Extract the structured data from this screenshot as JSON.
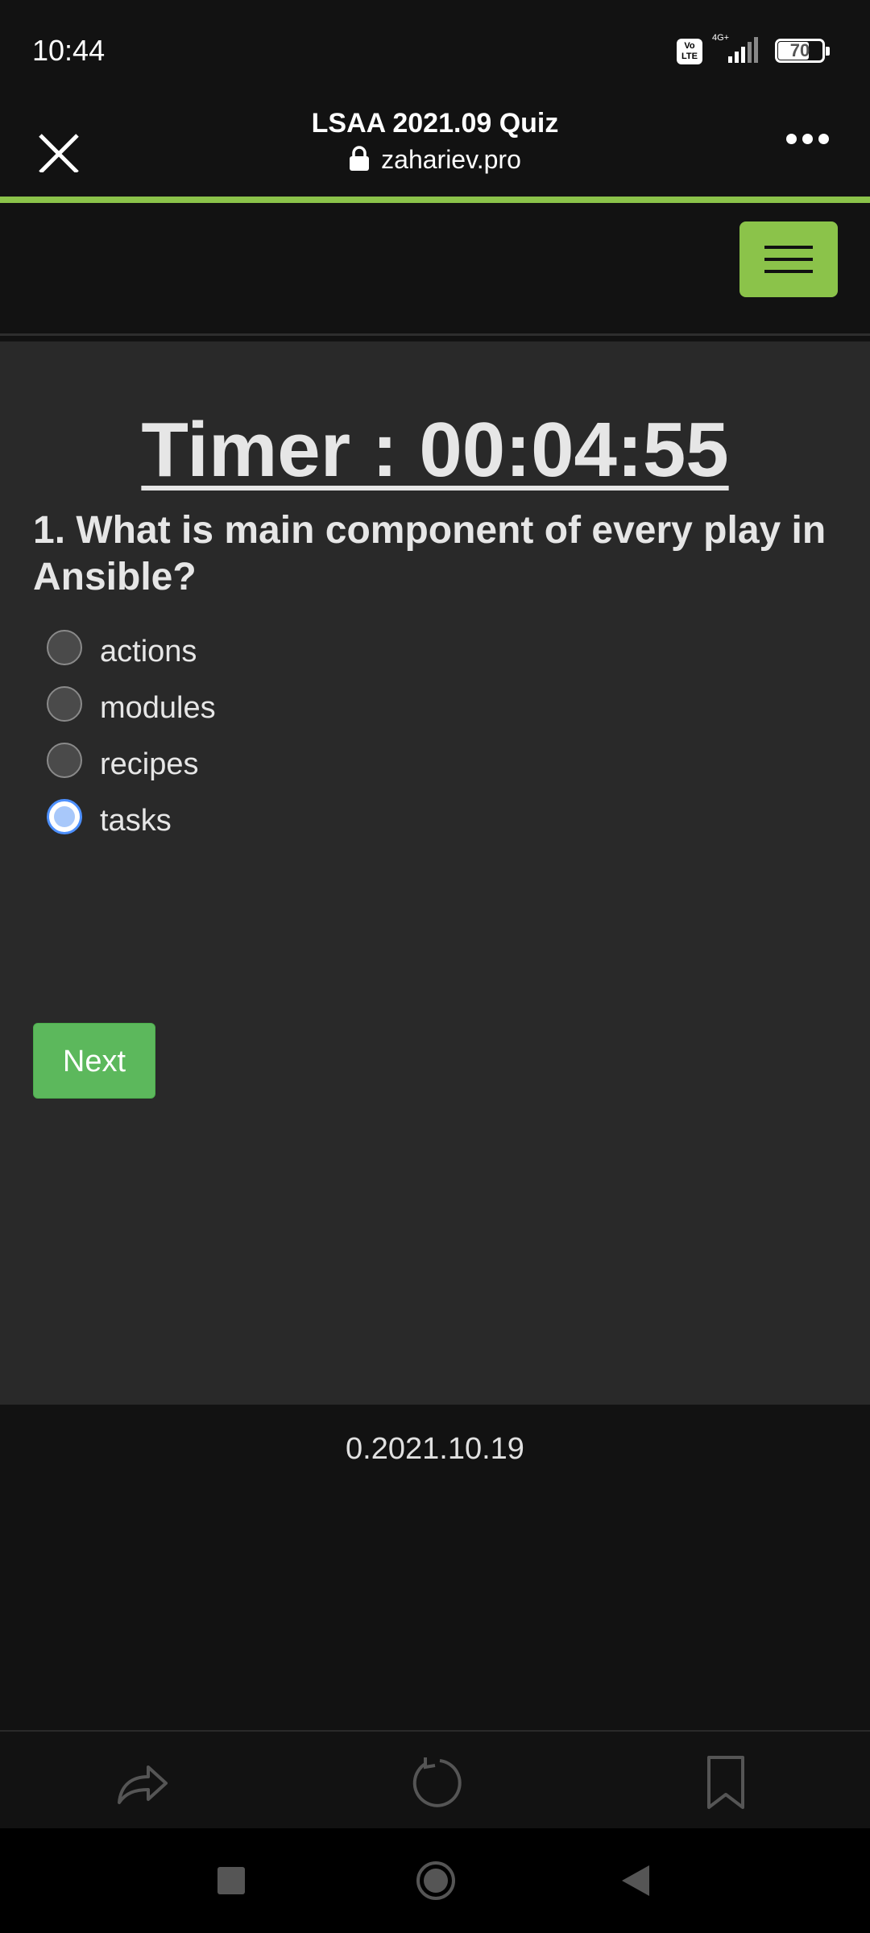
{
  "status_bar": {
    "time": "10:44",
    "volte_label": "Vo\nLTE",
    "network_label": "4G+",
    "battery_level": "70"
  },
  "browser": {
    "page_title": "LSAA 2021.09 Quiz",
    "url": "zahariev.pro",
    "accent_color": "#8bc34a"
  },
  "quiz": {
    "timer": "Timer : 00:04:55",
    "question": "1. What is main component of every play in Ansible?",
    "options": [
      {
        "label": "actions",
        "selected": false
      },
      {
        "label": "modules",
        "selected": false
      },
      {
        "label": "recipes",
        "selected": false
      },
      {
        "label": "tasks",
        "selected": true
      }
    ],
    "next_label": "Next"
  },
  "footer": {
    "version": "0.2021.10.19"
  },
  "icons": {
    "close": "close-icon",
    "lock": "lock-icon",
    "more": "more-icon",
    "menu": "hamburger-menu-icon",
    "share": "share-icon",
    "refresh": "refresh-icon",
    "bookmark": "bookmark-icon",
    "recents": "recents-square-icon",
    "home": "home-circle-icon",
    "back": "back-triangle-icon"
  }
}
